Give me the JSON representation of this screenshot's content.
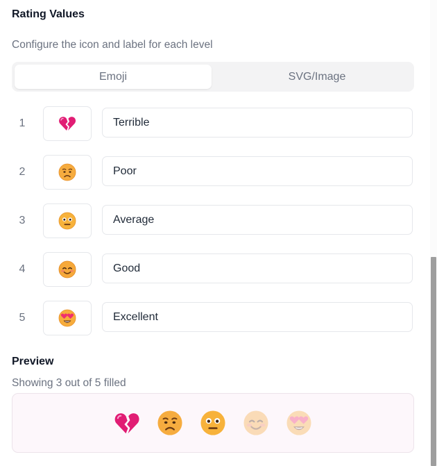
{
  "section": {
    "title": "Rating Values",
    "subtitle": "Configure the icon and label for each level"
  },
  "tabs": [
    {
      "label": "Emoji",
      "active": true
    },
    {
      "label": "SVG/Image",
      "active": false
    }
  ],
  "levels": [
    {
      "number": "1",
      "icon": "broken-heart-icon",
      "label": "Terrible"
    },
    {
      "number": "2",
      "icon": "worried-face-icon",
      "label": "Poor"
    },
    {
      "number": "3",
      "icon": "neutral-face-icon",
      "label": "Average"
    },
    {
      "number": "4",
      "icon": "smiling-face-icon",
      "label": "Good"
    },
    {
      "number": "5",
      "icon": "heart-eyes-face-icon",
      "label": "Excellent"
    }
  ],
  "preview": {
    "title": "Preview",
    "status": "Showing 3 out of 5 filled",
    "filled": 3,
    "total": 5
  }
}
